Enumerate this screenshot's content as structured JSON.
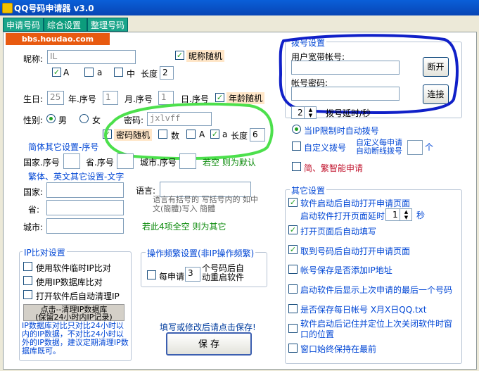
{
  "window": {
    "title": "QQ号码申请器 v3.0"
  },
  "tabs": [
    "申请号码",
    "综合设置",
    "整理号码"
  ],
  "watermark": "bbs.houdao.com",
  "profile": {
    "nickname_label": "昵称:",
    "nickname_value": "IL",
    "nickname_random": "昵称随机",
    "opt_A": "A",
    "opt_a": "a",
    "opt_zhong": "中",
    "length_label": "长度",
    "length_value": "2",
    "birthday_label": "生日:",
    "birthday_value": "25",
    "year_label": "年.序号",
    "year_value": "1",
    "month_label": "月.序号",
    "month_value": "1",
    "day_label": "日.序号",
    "age_random": "年龄随机",
    "gender_label": "性别:",
    "male": "男",
    "female": "女",
    "password_label": "密码:",
    "password_value": "jxlvff",
    "password_random": "密码随机",
    "digits": "数",
    "pw_A": "A",
    "pw_a": "a",
    "pw_length_label": "长度",
    "pw_length_value": "6"
  },
  "simplified": {
    "heading": "简体其它设置-序号",
    "country": "国家.序号",
    "province": "省.序号",
    "city": "城市.序号",
    "default_note": "若空 则为默认"
  },
  "traditional": {
    "heading": "繁体、英文其它设置-文字",
    "country": "国家:",
    "province": "省:",
    "city": "城市:",
    "language": "语言:",
    "language_note": "语言有括号的 写括号内的 如中文(簡體)写入 簡體",
    "empty_note": "若此4项全空 则为其它"
  },
  "dialup": {
    "title": "拨号设置",
    "account_label": "用户宽带帐号:",
    "password_label": "帐号密码:",
    "disconnect": "断开",
    "connect": "连接",
    "delay_value": "2",
    "delay_label": "拨号延时/秒",
    "auto_dial": "当IP限制时自动拨号",
    "custom_dial": "自定义拨号",
    "custom_per_line1": "自定义每申请",
    "custom_per_line2": "自动断线拨号",
    "custom_unit": "个",
    "smart_apply": "简、繁智能申请"
  },
  "other": {
    "title": "其它设置",
    "open_page": "软件启动后自动打开申请页面",
    "open_delay_label": "启动软件打开页面延时",
    "open_delay_value": "1",
    "open_delay_unit": "秒",
    "auto_fill": "打开页面后自动填写",
    "auto_open_on_number": "取到号码后自动打开申请页面",
    "add_ip": "帐号保存是否添加IP地址",
    "show_last": "启动软件后显示上次申请的最后一个号码",
    "save_daily": "是否保存每日帐号 X月X日QQ.txt",
    "remember_pos": "软件启动后记住并定位上次关闭软件时窗口的位置",
    "always_top": "窗口始终保持在最前"
  },
  "ipcompare": {
    "title": "IP比对设置",
    "temp_ip": "使用软件临时IP比对",
    "db_ip": "使用IP数据库比对",
    "auto_clean": "打开软件后自动清理IP",
    "clean_btn_line1": "点击--清理IP数据库",
    "clean_btn_line2": "(保留24小时内IP记录)",
    "note": "IP数据库对比只对比24小时以内的IP数据，不对比24小时以外的IP数据，建议定期清理IP数据库既可。"
  },
  "frequency": {
    "title": "操作频繁设置(非IP操作频繁)",
    "per_apply": "每申请",
    "count": "3",
    "restart_line1": "个号码后自",
    "restart_line2": "动重启软件"
  },
  "save": {
    "hint": "填写或修改后请点击保存!",
    "button": "保  存"
  }
}
